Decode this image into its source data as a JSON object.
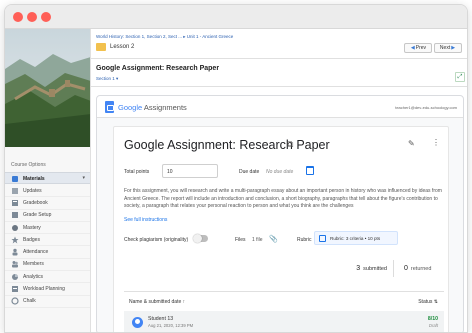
{
  "window": {
    "close_color": "#ff5f57",
    "minimize_color": "#ff5f57",
    "maximize_color": "#ff5f57"
  },
  "sidebar": {
    "course_options": "Course Options",
    "materials": "Materials",
    "items": [
      {
        "label": "Updates",
        "icon": "updates-icon"
      },
      {
        "label": "Gradebook",
        "icon": "gradebook-icon"
      },
      {
        "label": "Grade Setup",
        "icon": "grade-setup-icon"
      },
      {
        "label": "Mastery",
        "icon": "mastery-icon"
      },
      {
        "label": "Badges",
        "icon": "badges-icon"
      },
      {
        "label": "Attendance",
        "icon": "attendance-icon"
      },
      {
        "label": "Members",
        "icon": "members-icon"
      },
      {
        "label": "Analytics",
        "icon": "analytics-icon"
      },
      {
        "label": "Workload Planning",
        "icon": "workload-icon"
      },
      {
        "label": "Chalk",
        "icon": "chalk-icon"
      }
    ]
  },
  "topbar": {
    "breadcrumb": "World History: Section 1, Section 2, Sect ... ▸ Unit 1 - Ancient Greece",
    "lesson": "Lesson 2",
    "prev": "Prev",
    "next": "Next"
  },
  "page": {
    "title": "Google Assignment: Research Paper",
    "section": "Section 1 ▾"
  },
  "google": {
    "brand_google": "Google",
    "brand_assignments": "Assignments",
    "email": "teacher1@dev-edu-schoology.com",
    "assignment_title": "Google Assignment: Research Paper",
    "total_points_label": "Total points",
    "total_points_value": "10",
    "due_date_label": "Due date",
    "due_date_value": "No due date",
    "description": "For this assignment, you will research and write a multi-paragraph essay about an important person in history who was influenced by ideas from Ancient Greece. The report will include an introduction and conclusion, a short biography, paragraphs that tell about the figure's contribution to society, a paragraph that relates your personal reaction to person and what you think are the challenges",
    "full_instructions": "See full instructions",
    "plagiarism_label": "Check plagiarism (originality)",
    "files_label": "Files",
    "files_value": "1 file",
    "rubric_label": "Rubric",
    "rubric_value": "Rubric: 3 criteria • 10 pts",
    "submitted_count": "3",
    "submitted_label": "submitted",
    "returned_count": "0",
    "returned_label": "returned",
    "table_header_name": "Name & submitted date",
    "table_header_sort": "↑",
    "table_header_status": "Status",
    "table_header_status_sort": "⇅",
    "rows": [
      {
        "name": "Student 13",
        "date": "Aug 21, 2020, 12:39 PM",
        "grade": "8/10",
        "status": "Draft"
      }
    ]
  },
  "colors": {
    "accent": "#1a73e8",
    "link": "#2a5fb0",
    "grade_green": "#1e8e3e",
    "folder": "#f2c14e"
  }
}
